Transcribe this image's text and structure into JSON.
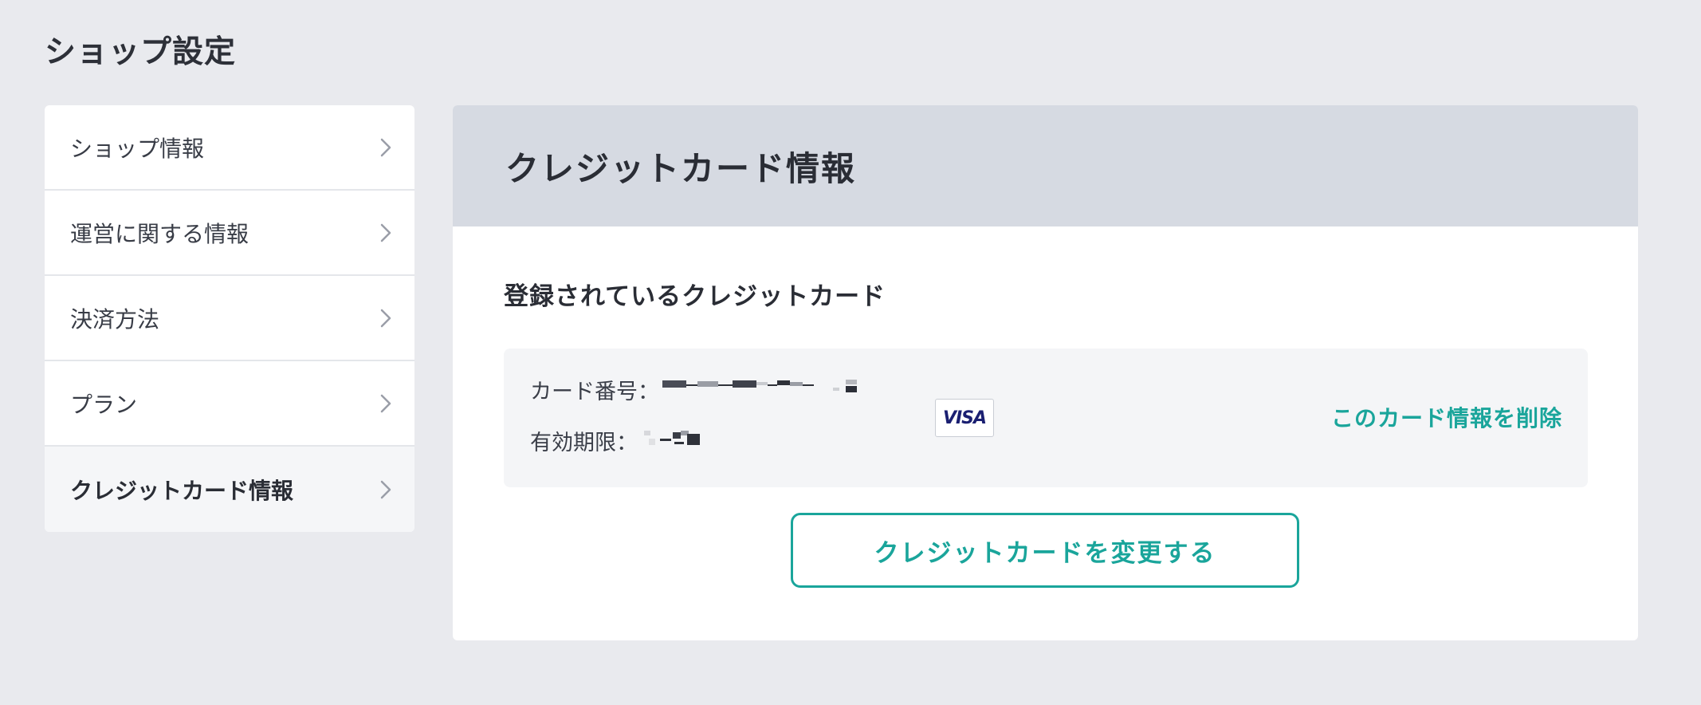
{
  "page": {
    "title": "ショップ設定"
  },
  "sidebar": {
    "items": [
      {
        "label": "ショップ情報",
        "icon": "chevron-right-icon"
      },
      {
        "label": "運営に関する情報",
        "icon": "chevron-right-icon"
      },
      {
        "label": "決済方法",
        "icon": "chevron-right-icon"
      },
      {
        "label": "プラン",
        "icon": "chevron-right-icon"
      },
      {
        "label": "クレジットカード情報",
        "icon": "chevron-right-icon",
        "active": true
      }
    ]
  },
  "main": {
    "header_title": "クレジットカード情報",
    "section_title": "登録されているクレジットカード",
    "card": {
      "number_label": "カード番号：",
      "expiry_label": "有効期限：",
      "brand": "VISA",
      "delete_label": "このカード情報を削除"
    },
    "change_button_label": "クレジットカードを変更する"
  },
  "colors": {
    "accent": "#1aa59b",
    "background": "#e9eaee",
    "header_bg": "#d6dae2",
    "visa_blue": "#1a1f71"
  }
}
